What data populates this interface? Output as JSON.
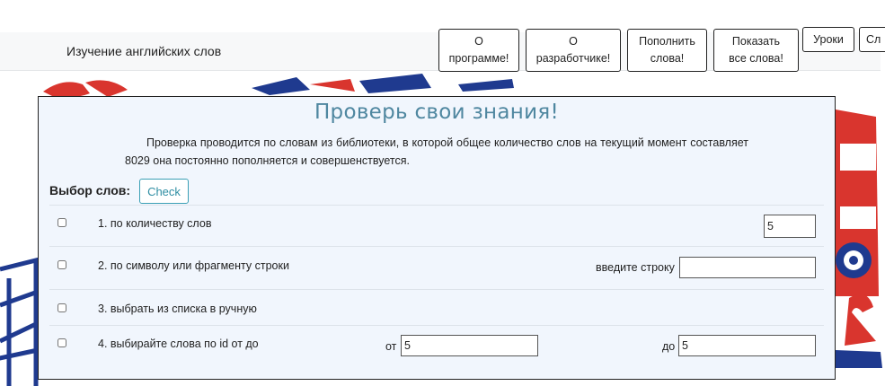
{
  "header": {
    "app_title": "Изучение английских слов",
    "nav": [
      {
        "id": "about-program",
        "label": "О\nпрограмме!"
      },
      {
        "id": "about-developer",
        "label": "О\nразработчике!"
      },
      {
        "id": "add-words",
        "label": "Пополнить\nслова!"
      },
      {
        "id": "show-all-words",
        "label": "Показать\nвсе слова!"
      },
      {
        "id": "lessons",
        "label": "Уроки"
      },
      {
        "id": "next",
        "label": "Сл"
      }
    ]
  },
  "panel": {
    "title": "Проверь свои знания!",
    "description": "Проверка проводится по словам из библиотеки, в которой общее количество слов на текущий момент составляет 8029 она постоянно пополняется и совершенствуется.",
    "select_label": "Выбор слов:",
    "check_label": "Check",
    "options": [
      {
        "label": "1. по количеству слов",
        "count_value": "5"
      },
      {
        "label": "2. по символу или фрагменту строки",
        "input_label": "введите строку",
        "input_value": ""
      },
      {
        "label": "3. выбрать из списка в ручную"
      },
      {
        "label": "4. выбирайте слова по id от до",
        "from_label": "от",
        "from_value": "5",
        "to_label": "до",
        "to_value": "5"
      }
    ]
  },
  "colors": {
    "accent": "#4f87a0",
    "panel_bg": "#f1f6fd",
    "check_border": "#3a9fb5",
    "art_red": "#d9352e",
    "art_blue": "#1f3a8f"
  }
}
